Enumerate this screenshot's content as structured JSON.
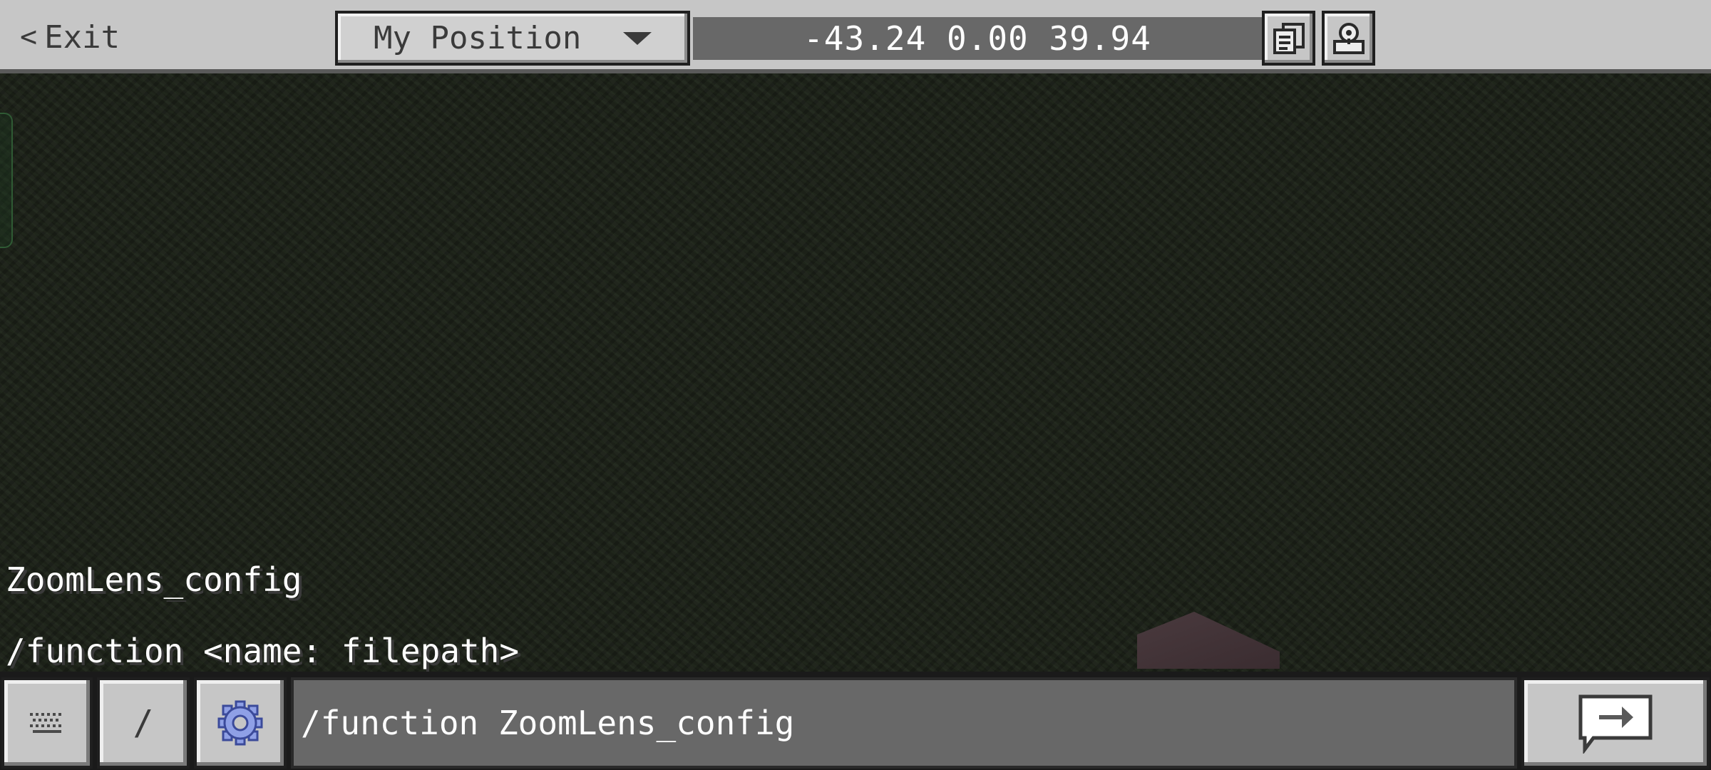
{
  "top_bar": {
    "exit_label": "Exit",
    "position_dropdown": {
      "selected": "My Position"
    },
    "coordinates": "-43.24 0.00 39.94"
  },
  "chat": {
    "message": "ZoomLens_config",
    "command_hint": "/function <name: filepath>"
  },
  "bottom_bar": {
    "slash_label": "/",
    "input_value": "/function ZoomLens_config"
  },
  "colors": {
    "toolbar": "#c6c6c6",
    "coords_bg": "#686868",
    "input_bg": "#686868",
    "settings_icon": "#8fa0e6"
  },
  "icons": {
    "back": "chevron-left-icon",
    "dropdown": "caret-down-icon",
    "copy": "copy-coordinates-icon",
    "teleport": "teleport-icon",
    "keyboard": "keyboard-icon",
    "settings": "gear-icon",
    "send": "send-arrow-icon"
  }
}
